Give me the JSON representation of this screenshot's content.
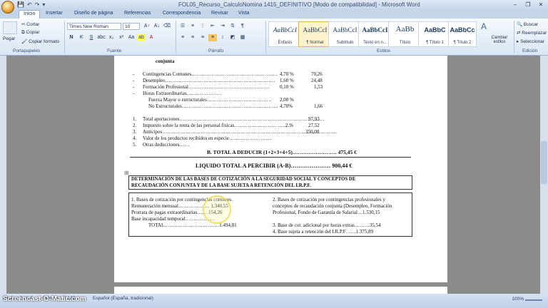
{
  "titlebar": {
    "title": "FOL05_Recurso_CalculoNomina 1415_DEFINITIVO [Modo de compatibilidad] - Microsoft Word",
    "qat_icons": [
      "save-icon",
      "undo-icon",
      "redo-icon",
      "customize-icon"
    ],
    "controls": [
      "–",
      "❐",
      "✕"
    ]
  },
  "tabs": [
    {
      "label": "Inicio"
    },
    {
      "label": "Insertar"
    },
    {
      "label": "Diseño de página"
    },
    {
      "label": "Referencias"
    },
    {
      "label": "Correspondencia"
    },
    {
      "label": "Revisar"
    },
    {
      "label": "Vista"
    }
  ],
  "ribbon": {
    "clipboard": {
      "paste": "Pegar",
      "cut": "Cortar",
      "copy": "Copiar",
      "format_painter": "Copiar formato",
      "label": "Portapapeles"
    },
    "font": {
      "family": "Times New Roman",
      "size": "10",
      "label": "Fuente"
    },
    "paragraph": {
      "label": "Párrafo"
    },
    "styles": {
      "items": [
        {
          "sample": "AaBbCcI",
          "name": "Énfasis"
        },
        {
          "sample": "AaBbCcI",
          "name": "¶ Normal"
        },
        {
          "sample": "AaBbCcI",
          "name": "Subtítulo"
        },
        {
          "sample": "AaBbCcI",
          "name": "Texto en n..."
        },
        {
          "sample": "AaBb",
          "name": "Título"
        },
        {
          "sample": "AaBbC",
          "name": "¶ Título 1"
        },
        {
          "sample": "AaBbCc",
          "name": "¶ Título 2"
        }
      ],
      "change": "Cambiar estilos",
      "label": "Estilos"
    },
    "editing": {
      "find": "Buscar",
      "replace": "Reemplazar",
      "select": "Seleccionar",
      "label": "Edición"
    }
  },
  "doc": {
    "heading_tail": "conjunta",
    "items": [
      {
        "bullet": "-",
        "label": "Contingencias Comunes…………………………………………….",
        "pct": "4,70 %",
        "amount": "70,26"
      },
      {
        "bullet": "-",
        "label": "Desempleo…………………………………………………………",
        "pct": "1,60 %",
        "amount": "24,48"
      },
      {
        "bullet": "-",
        "label": "Formación Profesional………………………………………….",
        "pct": "0,10 %",
        "amount": "1,53"
      },
      {
        "bullet": "-",
        "label": "Horas Extraordinarias…………………",
        "pct": "",
        "amount": ""
      },
      {
        "bullet": "",
        "label": "Fuerza Mayor o estructurales…………………………………",
        "pct": "2,00 %",
        "amount": ""
      },
      {
        "bullet": "",
        "label": "No Estructurales………………………………………………….",
        "pct": "4,70%",
        "amount": "1,66"
      }
    ],
    "numbered": [
      {
        "n": "1.",
        "label": "Total aportaciones……………………………………………………………………………",
        "pct": "",
        "amount": "97,93"
      },
      {
        "n": "2.",
        "label": "Impuesto sobre la renta de las personal físicas…………………………….",
        "pct": "2  %",
        "amount": "27,52"
      },
      {
        "n": "3.",
        "label": "Anticipos……………………………………………………………………………………………",
        "pct": "",
        "amount": "350,00"
      },
      {
        "n": "4.",
        "label": "Valor de los productos recibidos en especie……………………..",
        "pct": "",
        "amount": ""
      },
      {
        "n": "5.",
        "label": "Otras deducciones……",
        "pct": "",
        "amount": ""
      }
    ],
    "total_deduct": "B. TOTAL A DEDUCIR (1+2+3+4+5)…………………….   475,45 €",
    "liquido": "LIQUIDO TOTAL A PERCIBIR (A-B)…………………  900,44 €",
    "bases_title_1": "DETERMINACIÓN DE LAS BASES DE COTIZACIÓN A LA SEGURIDAD SOCIAL Y CONCEPTOS DE",
    "bases_title_2": "RECAUDACIÓN CONJUNTA Y DE LA BASE SUJETA A RETENCIÓN DEL I.R.P.F.",
    "left_col": [
      "1. Bases de cotización por contingencias comunes.",
      "Remuneración mensual……………….   1.340,55",
      "Prorrata de pagas extraordinarias……    154,26",
      "Base incapacidad temporal………………",
      "TOTAL……………………………1.494,81"
    ],
    "right_col": [
      "2. Bases de cotización por contingencias profesionales y",
      "conceptos de recaudación conjunta (Desempleo, Formación",
      "Profesional, Fondo de Garantía de Salarial…1.530,15",
      "",
      "3.  Base de cot. adicional por horas extras………35,54",
      "4.  Base sujeta a retención del I.R.P.F……1.375,89"
    ]
  },
  "status": {
    "page": "Página: 3 de 4",
    "words": "Palabras: 1.138",
    "language": "Español (España, tradicional)",
    "zoom": "100%"
  },
  "watermark": "Screencast-O-Matic.com"
}
